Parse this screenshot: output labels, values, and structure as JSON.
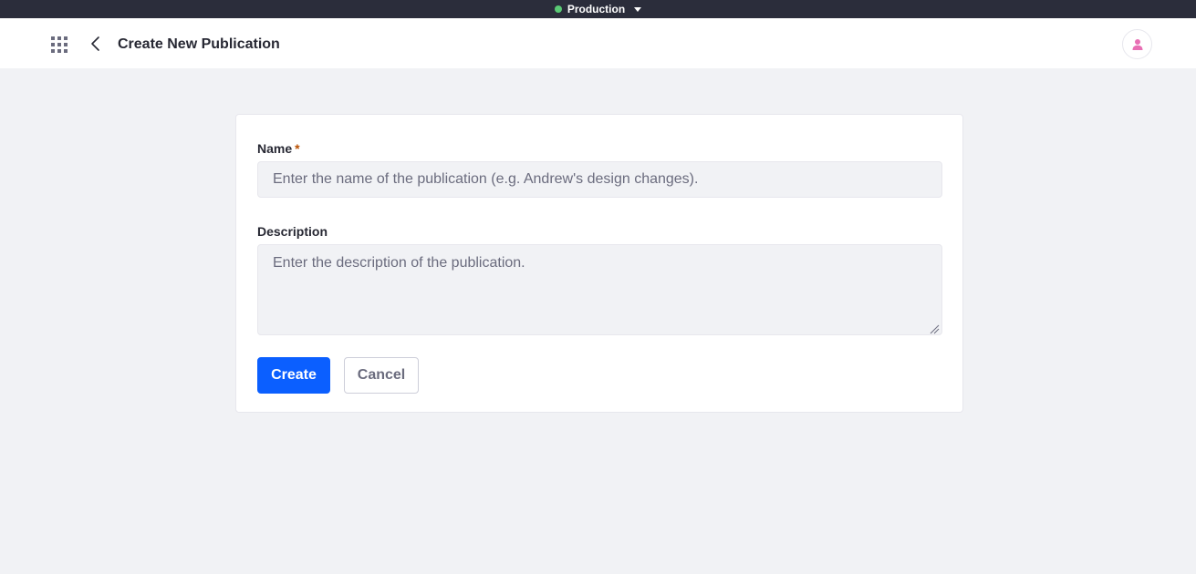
{
  "environment": {
    "label": "Production",
    "status_color": "#5aca75"
  },
  "header": {
    "title": "Create New Publication",
    "apps_icon": "grid-icon",
    "back_icon": "chevron-left-icon",
    "avatar_icon": "user-icon"
  },
  "form": {
    "name": {
      "label": "Name",
      "required_mark": "*",
      "value": "",
      "placeholder": "Enter the name of the publication (e.g. Andrew's design changes)."
    },
    "description": {
      "label": "Description",
      "value": "",
      "placeholder": "Enter the description of the publication."
    },
    "create_label": "Create",
    "cancel_label": "Cancel"
  },
  "colors": {
    "primary": "#0b5fff",
    "required": "#b95000",
    "avatar": "#e86fb4",
    "background": "#f1f2f5"
  }
}
